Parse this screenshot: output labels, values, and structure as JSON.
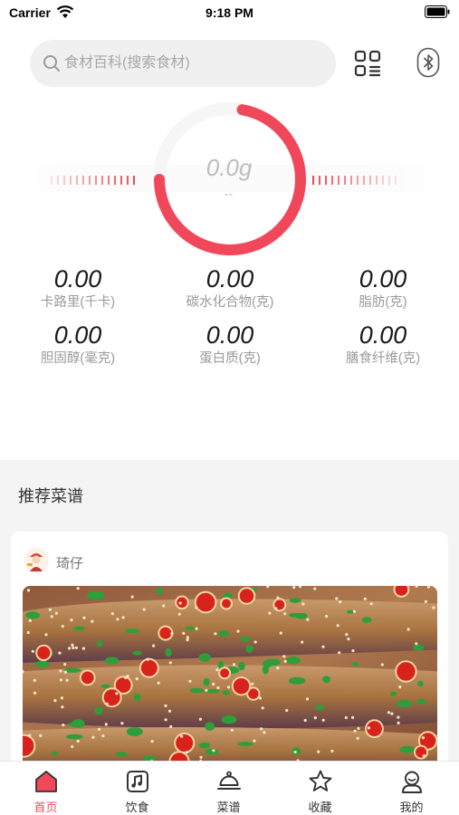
{
  "status_bar": {
    "carrier": "Carrier",
    "time": "9:18 PM"
  },
  "search": {
    "placeholder": "食材百科(搜索食材)"
  },
  "gauge": {
    "value": "0.0g",
    "sub": "--",
    "accent": "#f0485a"
  },
  "nutrition": [
    {
      "value": "0.00",
      "label": "卡路里(千卡)"
    },
    {
      "value": "0.00",
      "label": "碳水化合物(克)"
    },
    {
      "value": "0.00",
      "label": "脂肪(克)"
    },
    {
      "value": "0.00",
      "label": "胆固醇(毫克)"
    },
    {
      "value": "0.00",
      "label": "蛋白质(克)"
    },
    {
      "value": "0.00",
      "label": "膳食纤维(克)"
    }
  ],
  "recommend": {
    "title": "推荐菜谱",
    "card": {
      "author": "琦仔"
    }
  },
  "tabs": [
    {
      "label": "首页",
      "icon": "home-icon",
      "active": true
    },
    {
      "label": "饮食",
      "icon": "diet-icon",
      "active": false
    },
    {
      "label": "菜谱",
      "icon": "cloche-icon",
      "active": false
    },
    {
      "label": "收藏",
      "icon": "star-icon",
      "active": false
    },
    {
      "label": "我的",
      "icon": "profile-icon",
      "active": false
    }
  ]
}
